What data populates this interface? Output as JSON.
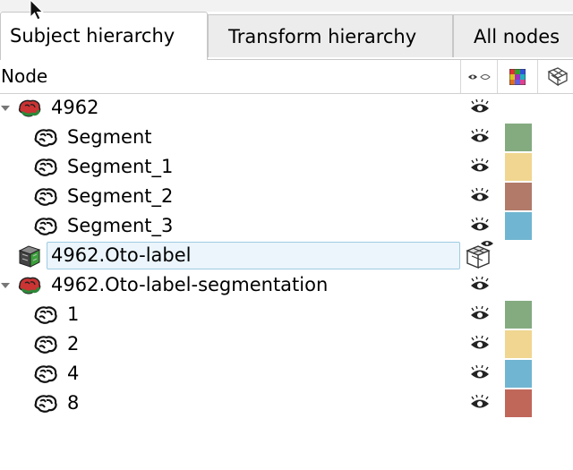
{
  "tabs": [
    {
      "label": "Subject hierarchy",
      "active": true
    },
    {
      "label": "Transform hierarchy",
      "active": false
    },
    {
      "label": "All nodes",
      "active": false
    }
  ],
  "header": {
    "node_label": "Node",
    "icons": [
      "visibility-column-icon",
      "color-column-icon",
      "transform-column-icon"
    ]
  },
  "rows": [
    {
      "type": "segmentation",
      "label": "4962",
      "expanded": true,
      "icon": "segmentation-icon"
    },
    {
      "type": "segment",
      "label": "Segment",
      "color": "#84ab80",
      "icon": "brain-segment-icon"
    },
    {
      "type": "segment",
      "label": "Segment_1",
      "color": "#f0d690",
      "icon": "brain-segment-icon"
    },
    {
      "type": "segment",
      "label": "Segment_2",
      "color": "#b17a69",
      "icon": "brain-segment-icon"
    },
    {
      "type": "segment",
      "label": "Segment_3",
      "color": "#70b5d2",
      "icon": "brain-segment-icon"
    },
    {
      "type": "labelmap",
      "label": "4962.Oto-label",
      "editing": true,
      "icon": "labelmap-volume-icon"
    },
    {
      "type": "segmentation",
      "label": "4962.Oto-label-segmentation",
      "expanded": true,
      "icon": "segmentation-icon"
    },
    {
      "type": "segment",
      "label": "1",
      "color": "#84ab80",
      "icon": "brain-segment-icon"
    },
    {
      "type": "segment",
      "label": "2",
      "color": "#f0d690",
      "icon": "brain-segment-icon"
    },
    {
      "type": "segment",
      "label": "4",
      "color": "#70b5d2",
      "icon": "brain-segment-icon"
    },
    {
      "type": "segment",
      "label": "8",
      "color": "#c0675a",
      "icon": "brain-segment-icon"
    }
  ]
}
